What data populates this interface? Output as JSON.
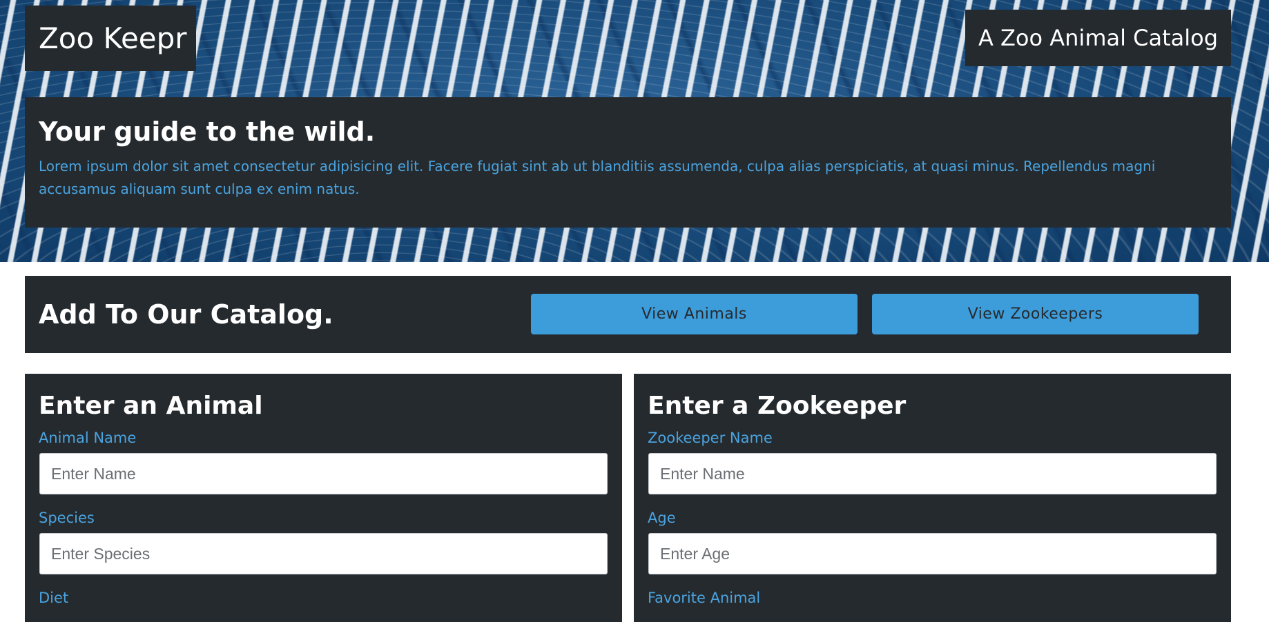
{
  "header": {
    "logo": "Zoo Keepr",
    "tagline": "A Zoo Animal Catalog"
  },
  "intro": {
    "title": "Your guide to the wild.",
    "text": "Lorem ipsum dolor sit amet consectetur adipisicing elit. Facere fugiat sint ab ut blanditiis assumenda, culpa alias perspiciatis, at quasi minus. Repellendus magni accusamus aliquam sunt culpa ex enim natus."
  },
  "catalog": {
    "title": "Add To Our Catalog.",
    "view_animals_label": "View Animals",
    "view_zookeepers_label": "View Zookeepers"
  },
  "animal_form": {
    "title": "Enter an Animal",
    "name_label": "Animal Name",
    "name_placeholder": "Enter Name",
    "species_label": "Species",
    "species_placeholder": "Enter Species",
    "diet_label": "Diet"
  },
  "zookeeper_form": {
    "title": "Enter a Zookeeper",
    "name_label": "Zookeeper Name",
    "name_placeholder": "Enter Name",
    "age_label": "Age",
    "age_placeholder": "Enter Age",
    "favorite_label": "Favorite Animal"
  },
  "colors": {
    "panel": "#252a2e",
    "accent": "#3d9ddb",
    "label_blue": "#4aa3df",
    "hero_blue": "#1b4d7e"
  }
}
